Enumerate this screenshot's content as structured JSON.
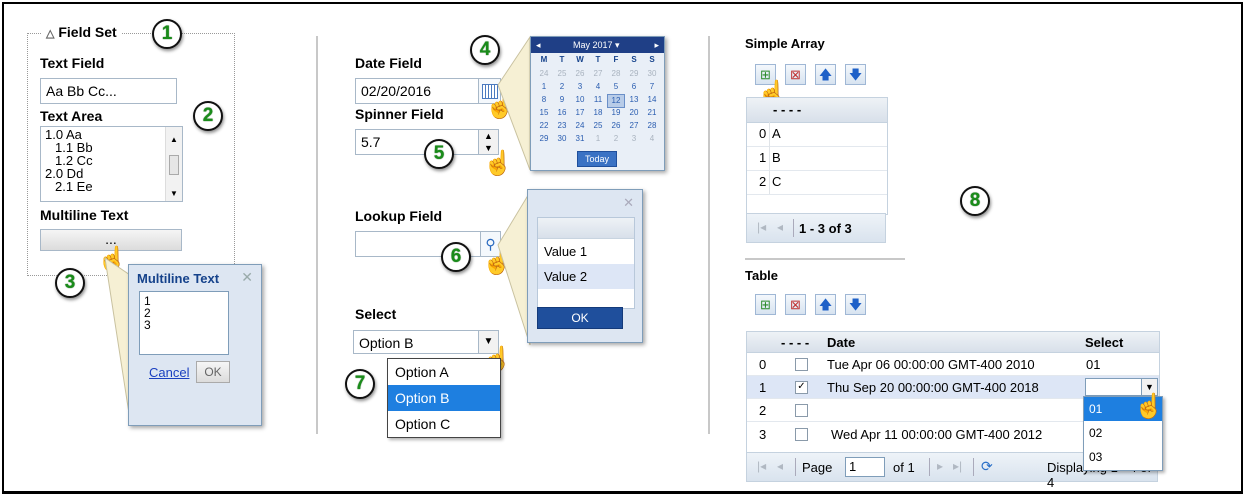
{
  "fieldset": {
    "legend": "Field Set",
    "text_field_label": "Text Field",
    "text_field_value": "Aa Bb Cc...",
    "text_area_label": "Text Area",
    "text_area_lines": [
      "1.0 Aa",
      "1.1 Bb",
      "1.2 Cc",
      "2.0 Dd",
      "2.1 Ee"
    ],
    "multiline_label": "Multiline Text",
    "multiline_button": "..."
  },
  "multiline_popup": {
    "title": "Multiline Text",
    "lines": [
      "1",
      "2",
      "3"
    ],
    "cancel": "Cancel",
    "ok": "OK"
  },
  "date_field": {
    "label": "Date Field",
    "value": "02/20/2016"
  },
  "calendar": {
    "month": "May 2017",
    "weekdays": [
      "M",
      "T",
      "W",
      "T",
      "F",
      "S",
      "S"
    ],
    "weeks": [
      [
        "24",
        "25",
        "26",
        "27",
        "28",
        "29",
        "30"
      ],
      [
        "1",
        "2",
        "3",
        "4",
        "5",
        "6",
        "7"
      ],
      [
        "8",
        "9",
        "10",
        "11",
        "12",
        "13",
        "14"
      ],
      [
        "15",
        "16",
        "17",
        "18",
        "19",
        "20",
        "21"
      ],
      [
        "22",
        "23",
        "24",
        "25",
        "26",
        "27",
        "28"
      ],
      [
        "29",
        "30",
        "31",
        "1",
        "2",
        "3",
        "4"
      ]
    ],
    "today": "Today"
  },
  "spinner_field": {
    "label": "Spinner Field",
    "value": "5.7"
  },
  "lookup_field": {
    "label": "Lookup Field",
    "value": ""
  },
  "lookup_popup": {
    "options": [
      "Value 1",
      "Value 2"
    ],
    "ok": "OK"
  },
  "select_field": {
    "label": "Select",
    "value": "Option B",
    "options": [
      "Option A",
      "Option B",
      "Option C"
    ]
  },
  "simple_array": {
    "title": "Simple Array",
    "header": "- - - -",
    "rows": [
      {
        "index": "0",
        "value": "A"
      },
      {
        "index": "1",
        "value": "B"
      },
      {
        "index": "2",
        "value": "C"
      }
    ],
    "pager_text": "1 - 3 of 3"
  },
  "table": {
    "title": "Table",
    "headers": {
      "marker": "- - - -",
      "date": "Date",
      "select": "Select"
    },
    "rows": [
      {
        "index": "0",
        "checked": "",
        "date": "Tue Apr 06 00:00:00 GMT-400 2010",
        "select": "01"
      },
      {
        "index": "1",
        "checked": "✓",
        "date": "Thu Sep 20 00:00:00 GMT-400 2018",
        "select": ""
      },
      {
        "index": "2",
        "checked": "",
        "date": "",
        "select": ""
      },
      {
        "index": "3",
        "checked": "",
        "date": "Wed Apr 11 00:00:00 GMT-400 2012",
        "select": "02"
      }
    ],
    "dropdown_options": [
      "01",
      "02",
      "03"
    ],
    "pager": {
      "page_label": "Page",
      "page_value": "1",
      "of": "of 1",
      "displaying": "Displaying 1 - 4 of 4"
    }
  },
  "callouts": [
    "1",
    "2",
    "3",
    "4",
    "5",
    "6",
    "7",
    "8"
  ],
  "colors": {
    "accent_blue": "#1e7fe0",
    "popup_bg": "#dde6f2",
    "calendar_header": "#1f3f86",
    "callout_green": "#1a8c1a"
  }
}
